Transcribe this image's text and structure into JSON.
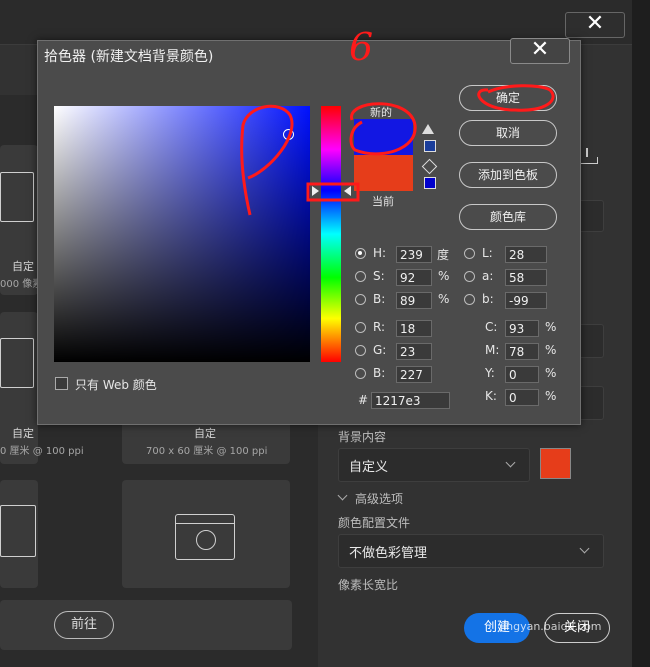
{
  "background_dialog": {
    "close_glyph": "✕",
    "presets": [
      {
        "name": "自定",
        "size": "000 像素"
      },
      {
        "name": "自定",
        "size": "0 厘米 @ 100 ppi"
      },
      {
        "name": "自定",
        "size": "700 x 60 厘米 @ 100 ppi"
      }
    ],
    "bg_content_label": "背景内容",
    "bg_content_value": "自定义",
    "bg_swatch_color": "#e63d1a",
    "advanced_label": "高级选项",
    "color_profile_label": "颜色配置文件",
    "color_profile_value": "不做色彩管理",
    "pixel_aspect_label": "像素长宽比",
    "prev_button": "前往",
    "create_button": "创建",
    "close_button": "关闭"
  },
  "color_picker": {
    "title": "拾色器 (新建文档背景颜色)",
    "close_glyph": "✕",
    "new_label": "新的",
    "current_label": "当前",
    "new_color": "#1217e3",
    "current_color": "#e63d1a",
    "buttons": {
      "ok": "确定",
      "cancel": "取消",
      "add_swatch": "添加到色板",
      "color_library": "颜色库"
    },
    "hsb": {
      "h": {
        "label": "H:",
        "value": "239",
        "unit": "度"
      },
      "s": {
        "label": "S:",
        "value": "92",
        "unit": "%"
      },
      "b": {
        "label": "B:",
        "value": "89",
        "unit": "%"
      }
    },
    "lab": {
      "l": {
        "label": "L:",
        "value": "28"
      },
      "a": {
        "label": "a:",
        "value": "58"
      },
      "b": {
        "label": "b:",
        "value": "-99"
      }
    },
    "rgb": {
      "r": {
        "label": "R:",
        "value": "18"
      },
      "g": {
        "label": "G:",
        "value": "23"
      },
      "b": {
        "label": "B:",
        "value": "227"
      }
    },
    "cmyk": {
      "c": {
        "label": "C:",
        "value": "93",
        "unit": "%"
      },
      "m": {
        "label": "M:",
        "value": "78",
        "unit": "%"
      },
      "y": {
        "label": "Y:",
        "value": "0",
        "unit": "%"
      },
      "k": {
        "label": "K:",
        "value": "0",
        "unit": "%"
      }
    },
    "hex": {
      "label": "#",
      "value": "1217e3"
    },
    "web_only_label": "只有 Web 颜色"
  },
  "watermark": "jingyan.baidu.com",
  "annotation_digit": "6"
}
